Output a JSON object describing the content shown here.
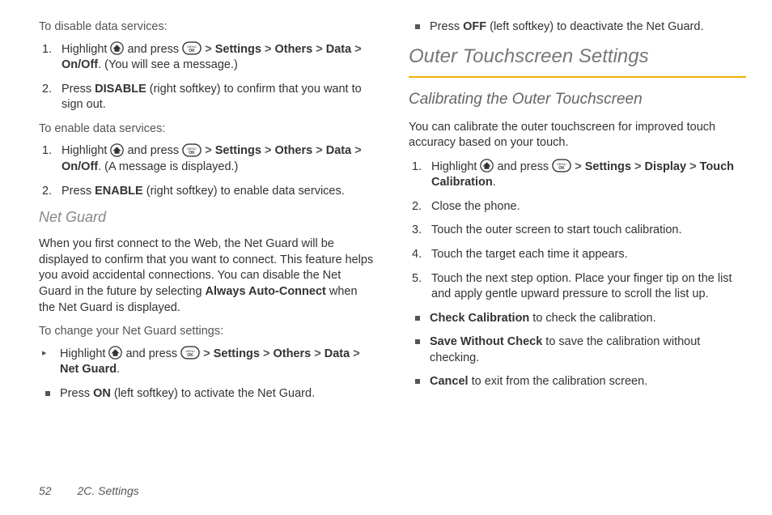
{
  "left": {
    "disable_intro": "To disable data services:",
    "disable_steps": [
      {
        "pre": "Highlight ",
        "mid": " and press ",
        "path1": "Settings",
        "path2": "Others",
        "path3": "Data",
        "path4": "On/Off",
        "tail": ". (You will see a message.)"
      },
      {
        "pre": "Press ",
        "bold": "DISABLE",
        "tail": " (right softkey) to confirm that you want to sign out."
      }
    ],
    "enable_intro": "To enable data services:",
    "enable_steps": [
      {
        "pre": "Highlight ",
        "mid": " and press ",
        "path1": "Settings",
        "path2": "Others",
        "path3": "Data",
        "path4": "On/Off",
        "tail": ". (A message is displayed.)"
      },
      {
        "pre": "Press ",
        "bold": "ENABLE",
        "tail": " (right softkey) to enable data services."
      }
    ],
    "netguard_heading": "Net Guard",
    "netguard_para_pre": "When you first connect to the Web, the Net Guard will be displayed to confirm that you want to connect. This feature helps you avoid accidental connections. You can disable the Net Guard in the future by selecting ",
    "netguard_para_bold": "Always Auto-Connect",
    "netguard_para_post": " when the Net Guard is displayed.",
    "netguard_change_intro": "To change your Net Guard settings:",
    "netguard_bullet": {
      "pre": "Highlight ",
      "mid": " and press ",
      "path1": "Settings",
      "path2": "Others",
      "path3": "Data",
      "path4": "Net Guard",
      "tail": "."
    },
    "netguard_on": {
      "pre": "Press ",
      "bold": "ON",
      "tail": " (left softkey) to activate the Net Guard."
    }
  },
  "right": {
    "off_item": {
      "pre": "Press ",
      "bold": "OFF",
      "tail": " (left softkey) to deactivate the Net Guard."
    },
    "outer_heading": "Outer Touchscreen Settings",
    "calib_heading": "Calibrating the Outer Touchscreen",
    "calib_intro": "You can calibrate the outer touchscreen for improved touch accuracy based on your touch.",
    "steps": [
      {
        "pre": "Highlight ",
        "mid": " and press ",
        "path1": "Settings",
        "path2": "Display",
        "path3": "Touch Calibration",
        "tail": "."
      },
      {
        "text": "Close the phone."
      },
      {
        "text": "Touch the outer screen to start touch calibration."
      },
      {
        "text": "Touch the target each time it appears."
      },
      {
        "text": "Touch the next step option. Place your finger tip on the list and apply gentle upward pressure to scroll the list up."
      }
    ],
    "options": [
      {
        "bold": "Check Calibration",
        "tail": " to check the calibration."
      },
      {
        "bold": "Save Without Check",
        "tail": " to save the calibration without checking."
      },
      {
        "bold": "Cancel",
        "tail": " to exit from the calibration screen."
      }
    ]
  },
  "footer": {
    "page": "52",
    "section": "2C. Settings"
  }
}
